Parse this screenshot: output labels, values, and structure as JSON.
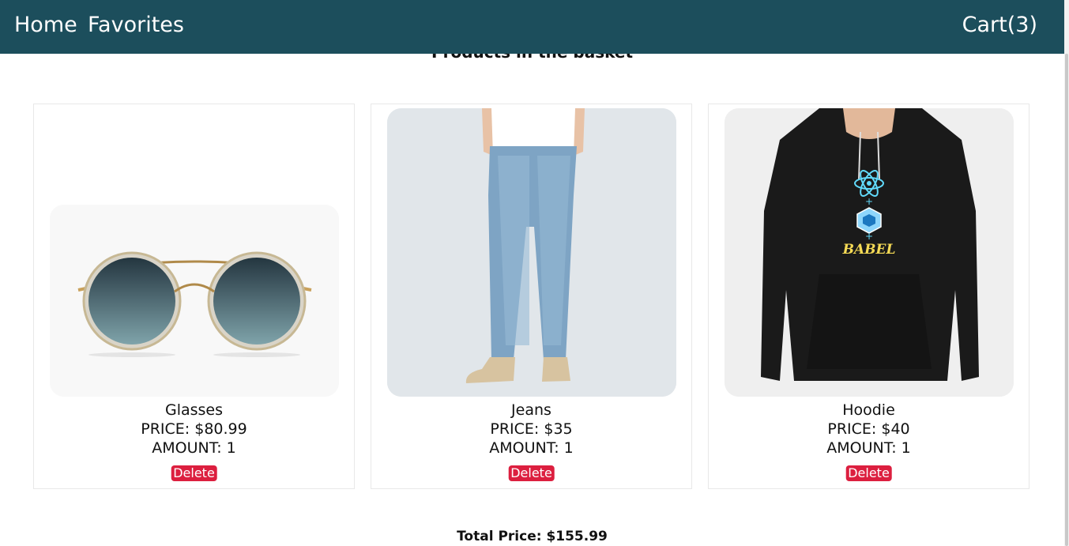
{
  "nav": {
    "home_label": "Home",
    "favorites_label": "Favorites",
    "cart_label": "Cart(3)"
  },
  "page": {
    "heading": "Products in the basket"
  },
  "products": [
    {
      "name": "Glasses",
      "price": "PRICE: $80.99",
      "amount": "AMOUNT: 1",
      "delete_label": "Delete",
      "image": "sunglasses-image"
    },
    {
      "name": "Jeans",
      "price": "PRICE: $35",
      "amount": "AMOUNT: 1",
      "delete_label": "Delete",
      "image": "jeans-image"
    },
    {
      "name": "Hoodie",
      "price": "PRICE: $40",
      "amount": "AMOUNT: 1",
      "delete_label": "Delete",
      "image": "hoodie-image"
    }
  ],
  "summary": {
    "total": "Total Price: $155.99"
  },
  "colors": {
    "navbar": "#1c4e5c",
    "delete_button": "#dc1f3f"
  }
}
